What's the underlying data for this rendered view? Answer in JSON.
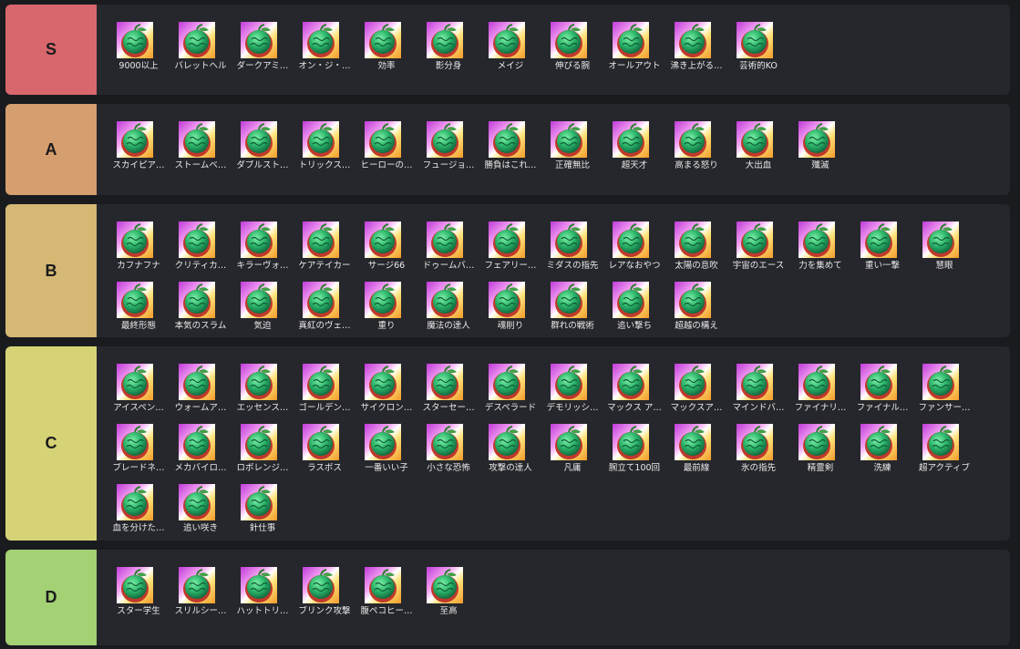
{
  "colors": {
    "background": "#1a1b1f",
    "row": "#26272c",
    "text": "#e9e9ea"
  },
  "item_icon": "devil-fruit-icon",
  "tiers": [
    {
      "label": "S",
      "color": "#d8676d",
      "items": [
        "9000以上",
        "バレットヘル",
        "ダークアミ…",
        "オン・ジ・…",
        "効率",
        "影分身",
        "メイジ",
        "伸びる腕",
        "オールアウト",
        "沸き上がる…",
        "芸術的KO"
      ]
    },
    {
      "label": "A",
      "color": "#d59e6e",
      "items": [
        "スカイピア…",
        "ストームベ…",
        "ダブルスト…",
        "トリックス…",
        "ヒーローの…",
        "フュージョ…",
        "勝負はこれ…",
        "正確無比",
        "超天才",
        "高まる怒り",
        "大出血",
        "殲滅"
      ]
    },
    {
      "label": "B",
      "color": "#d4b873",
      "items": [
        "カフナフナ",
        "クリティカ…",
        "キラーヴォ…",
        "ケアテイカー",
        "サージ66",
        "ドゥームバ…",
        "フェアリー…",
        "ミダスの指先",
        "レアなおやつ",
        "太陽の息吹",
        "宇宙のエース",
        "力を集めて",
        "重い一撃",
        "慧眼",
        "最終形態",
        "本気のスラム",
        "気迫",
        "真紅のヴェ…",
        "重り",
        "魔法の達人",
        "魂削り",
        "群れの戦術",
        "追い撃ち",
        "超越の構え"
      ]
    },
    {
      "label": "C",
      "color": "#d6d377",
      "items": [
        "アイスペン…",
        "ウォームア…",
        "エッセンス…",
        "ゴールデン…",
        "サイクロン…",
        "スターセー…",
        "デスペラード",
        "デモリッシ…",
        "マックス ア…",
        "マックスア…",
        "マインドバ…",
        "ファイナリ…",
        "ファイナル…",
        "ファンサー…",
        "ブレードネ…",
        "メカバイロ…",
        "ロボレンジ…",
        "ラスボス",
        "一番いい子",
        "小さな恐怖",
        "攻撃の達人",
        "凡庸",
        "腕立て100回",
        "最前線",
        "氷の指先",
        "精霊剣",
        "洗練",
        "超アクティブ",
        "血を分けた…",
        "追い咲き",
        "針仕事"
      ]
    },
    {
      "label": "D",
      "color": "#a3d173",
      "items": [
        "スター学生",
        "スリルシー…",
        "ハットトリ…",
        "ブリンク攻撃",
        "腹ペコヒー…",
        "至高"
      ]
    }
  ]
}
